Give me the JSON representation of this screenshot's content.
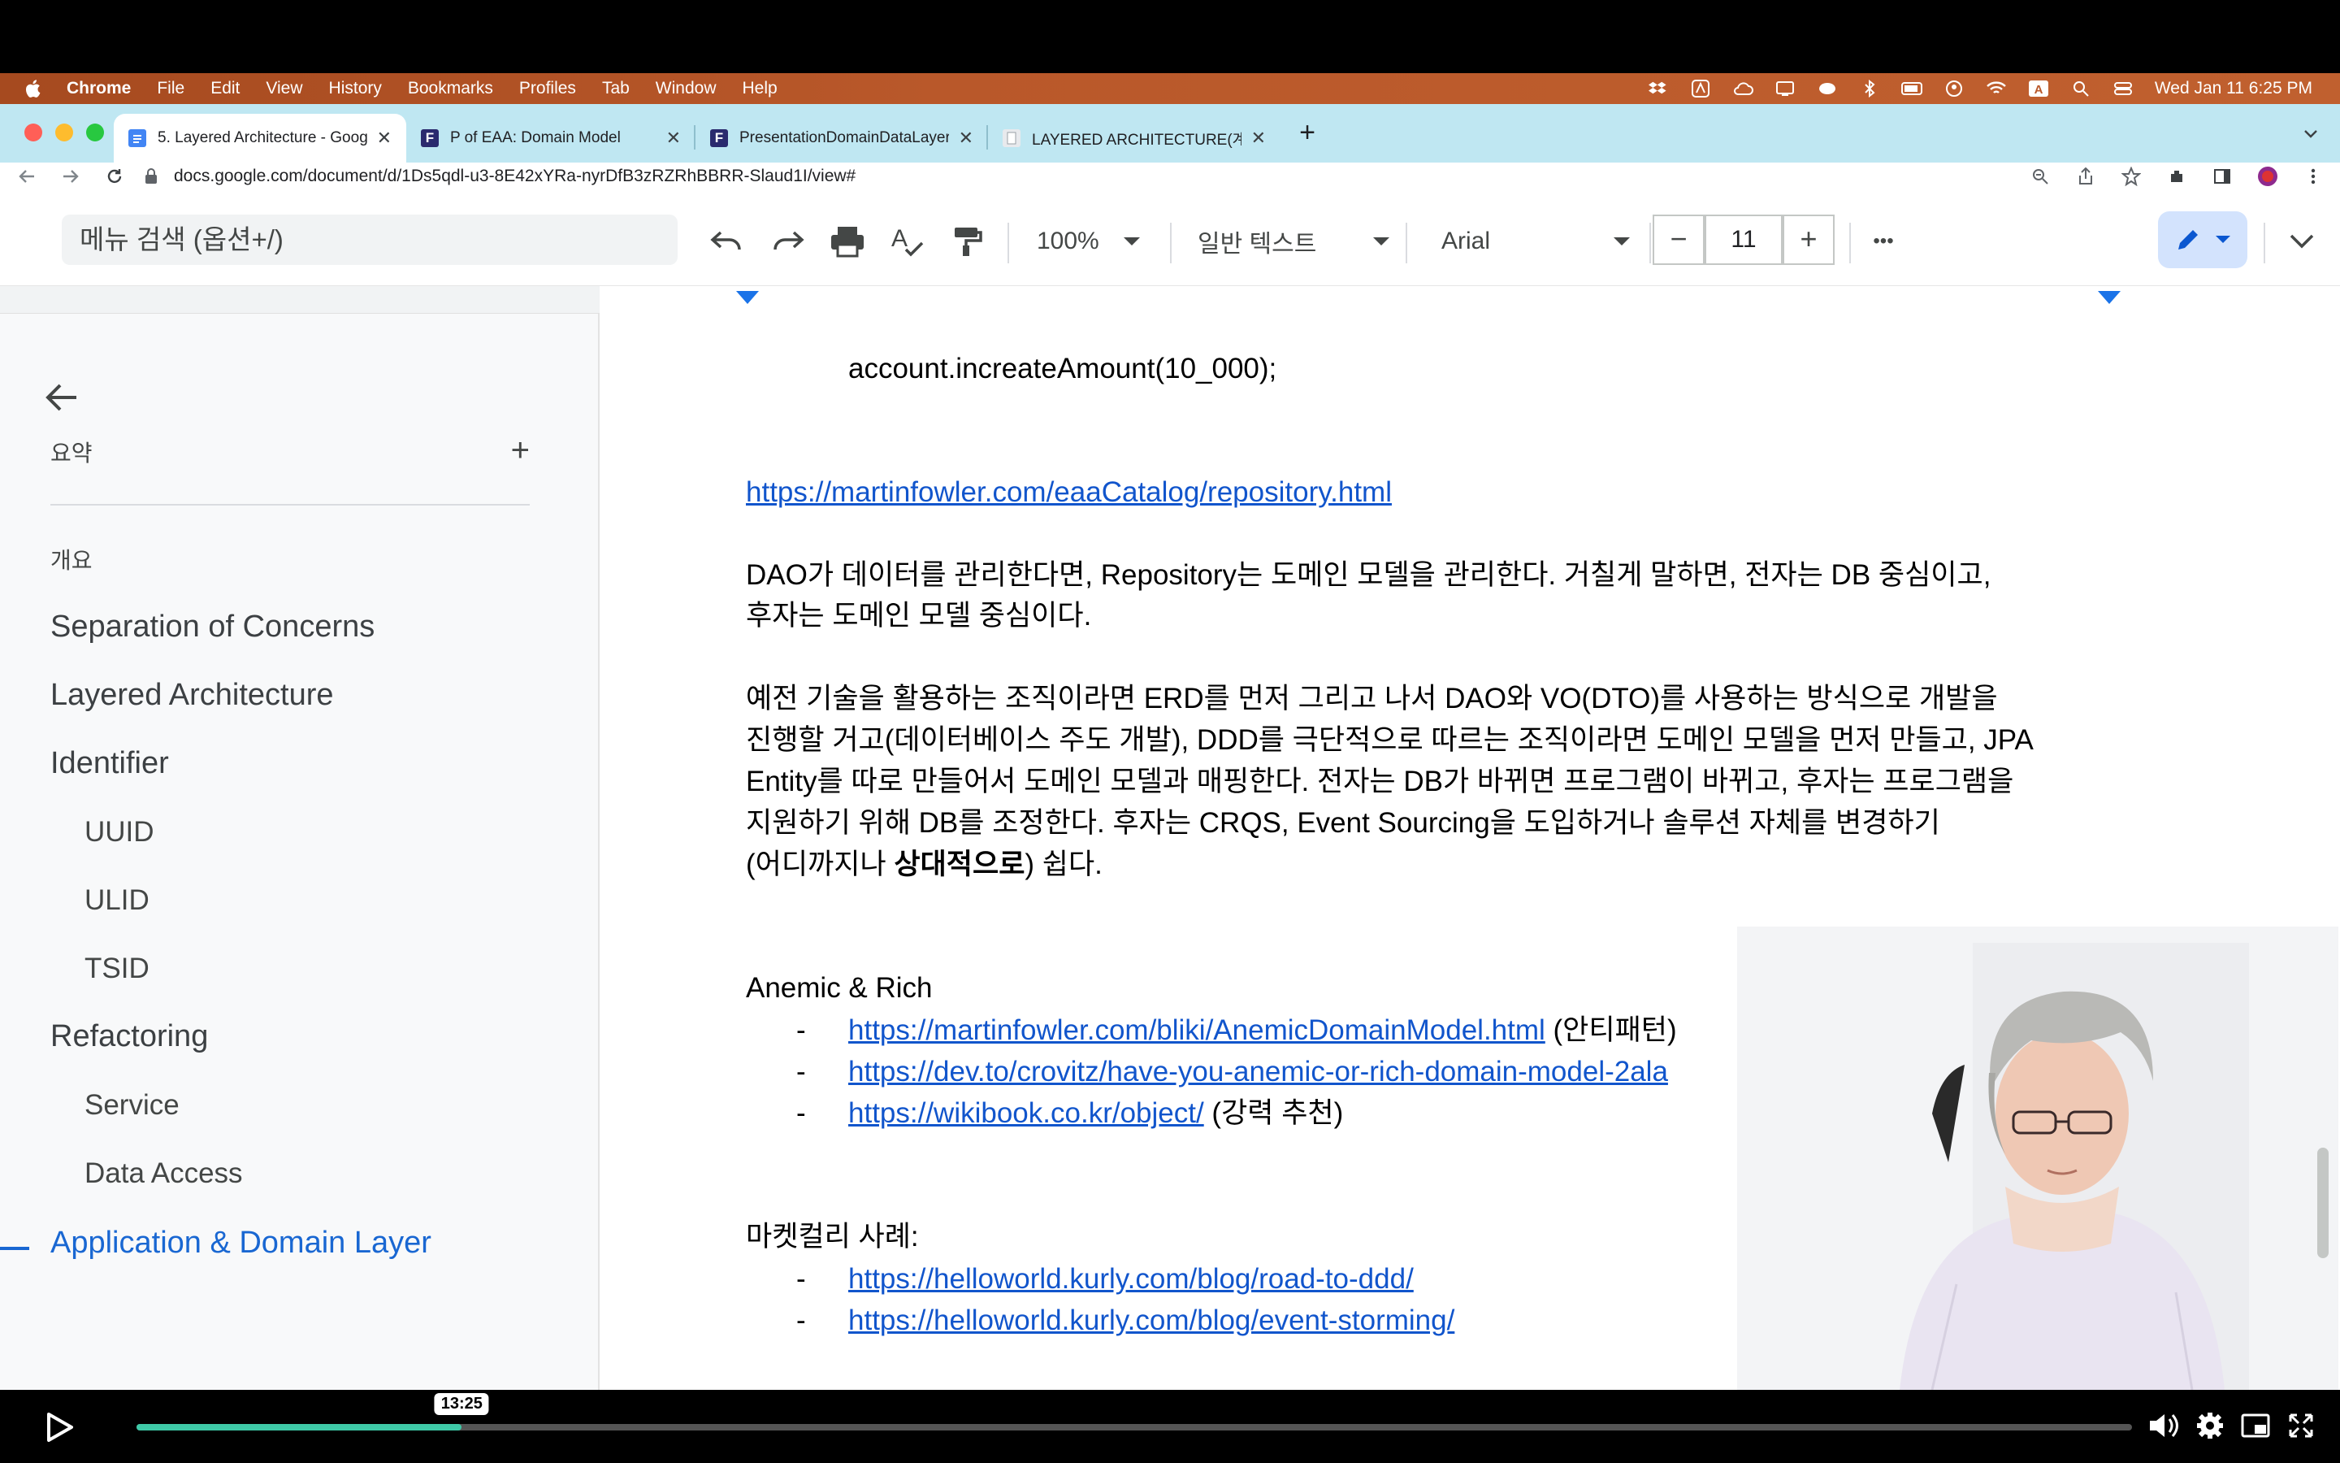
{
  "menubar": {
    "app": "Chrome",
    "items": [
      "File",
      "Edit",
      "View",
      "History",
      "Bookmarks",
      "Profiles",
      "Tab",
      "Window",
      "Help"
    ],
    "clock": "Wed Jan 11  6:25 PM",
    "status_icons": [
      "dropbox-icon",
      "adobe-icon",
      "cloud-icon",
      "display-icon",
      "coffee-icon",
      "bluetooth-icon",
      "battery-icon",
      "user-icon",
      "wifi-icon",
      "input-source-icon",
      "spotlight-icon",
      "control-center-icon"
    ]
  },
  "tabs": [
    {
      "title": "5. Layered Architecture - Goog",
      "icon": "google-docs-icon",
      "active": true
    },
    {
      "title": "P of EAA: Domain Model",
      "icon": "fowler-favicon",
      "active": false
    },
    {
      "title": "PresentationDomainDataLayer",
      "icon": "fowler-favicon",
      "active": false
    },
    {
      "title": "LAYERED ARCHITECTURE(계층",
      "icon": "page-favicon",
      "active": false
    }
  ],
  "address": {
    "url": "docs.google.com/document/d/1Ds5qdl-u3-8E42xYRa-nyrDfB3zRZRhBBRR-Slaud1I/view#"
  },
  "docs_toolbar": {
    "menu_search_placeholder": "메뉴 검색 (옵션+/)",
    "zoom": "100%",
    "style": "일반 텍스트",
    "font": "Arial",
    "font_size": "11",
    "minus": "−",
    "plus": "+",
    "more": "•••"
  },
  "outline": {
    "summary_label": "요약",
    "summary_add": "+",
    "overview_label": "개요",
    "items": [
      {
        "label": "Separation of Concerns",
        "level": 1,
        "active": false
      },
      {
        "label": "Layered Architecture",
        "level": 1,
        "active": false
      },
      {
        "label": "Identifier",
        "level": 1,
        "active": false
      },
      {
        "label": "UUID",
        "level": 2,
        "active": false
      },
      {
        "label": "ULID",
        "level": 2,
        "active": false
      },
      {
        "label": "TSID",
        "level": 2,
        "active": false
      },
      {
        "label": "Refactoring",
        "level": 1,
        "active": false
      },
      {
        "label": "Service",
        "level": 2,
        "active": false
      },
      {
        "label": "Data Access",
        "level": 2,
        "active": false
      },
      {
        "label": "Application & Domain Layer",
        "level": 1,
        "active": true
      }
    ]
  },
  "document": {
    "code_line": "account.increateAmount(10_000);",
    "repo_link": "https://martinfowler.com/eaaCatalog/repository.html",
    "para1_line1": "DAO가 데이터를 관리한다면, Repository는 도메인 모델을 관리한다. 거칠게 말하면, 전자는 DB 중심이고,",
    "para1_line2": "후자는 도메인 모델 중심이다.",
    "para2_line1": "예전 기술을 활용하는 조직이라면 ERD를 먼저 그리고 나서 DAO와 VO(DTO)를 사용하는 방식으로 개발을",
    "para2_line2": "진행할 거고(데이터베이스 주도 개발), DDD를 극단적으로 따르는 조직이라면 도메인 모델을 먼저 만들고, JPA",
    "para2_line3": "Entity를 따로 만들어서 도메인 모델과 매핑한다. 전자는 DB가 바뀌면 프로그램이 바뀌고, 후자는 프로그램을",
    "para2_line4": "지원하기 위해 DB를 조정한다. 후자는 CRQS, Event Sourcing을 도입하거나 솔루션 자체를 변경하기",
    "para2_line5_pre": "(어디까지나 ",
    "para2_line5_bold": "상대적으로",
    "para2_line5_post": ") 쉽다.",
    "anemic_heading": "Anemic & Rich",
    "anemic_links": [
      {
        "url": "https://martinfowler.com/bliki/AnemicDomainModel.html",
        "note": " (안티패턴)"
      },
      {
        "url": "https://dev.to/crovitz/have-you-anemic-or-rich-domain-model-2ala",
        "note": ""
      },
      {
        "url": "https://wikibook.co.kr/object/",
        "note": " (강력 추천)"
      }
    ],
    "kurly_heading": "마켓컬리 사례:",
    "kurly_links": [
      {
        "url": "https://helloworld.kurly.com/blog/road-to-ddd/"
      },
      {
        "url": "https://helloworld.kurly.com/blog/event-storming/"
      }
    ],
    "bullet": "-"
  },
  "player": {
    "time": "13:25",
    "progress": 0.163
  }
}
